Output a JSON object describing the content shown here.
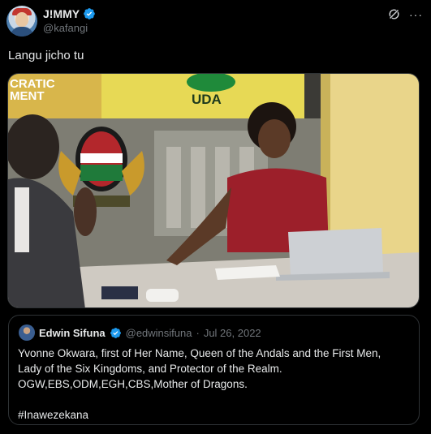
{
  "author": {
    "display_name": "J!MMY",
    "handle": "@kafangi",
    "verified_color": "#1d9bf0",
    "avatar_icon": "avatar-illustration"
  },
  "top_icons": {
    "grok_icon": "grok-icon",
    "more_label": "···"
  },
  "tweet": {
    "text": "Langu jicho tu"
  },
  "media": {
    "description_icon": "news-studio-image",
    "backdrop_text_left_1": "CRATIC",
    "backdrop_text_left_2": "MENT",
    "backdrop_logo_text": "UDA"
  },
  "quote": {
    "display_name": "Edwin Sifuna",
    "handle": "@edwinsifuna",
    "separator": "·",
    "date": "Jul 26, 2022",
    "line1": "Yvonne Okwara, first of Her Name, Queen of the Andals and the First Men,",
    "line2": "Lady of the Six Kingdoms, and Protector of the Realm.",
    "line3": "OGW,EBS,ODM,EGH,CBS,Mother of Dragons.",
    "hashtag": "#Inawezekana"
  },
  "colors": {
    "background": "#000000",
    "text": "#e7e9ea",
    "muted": "#71767b",
    "border": "#2f3336",
    "accent": "#1d9bf0"
  }
}
